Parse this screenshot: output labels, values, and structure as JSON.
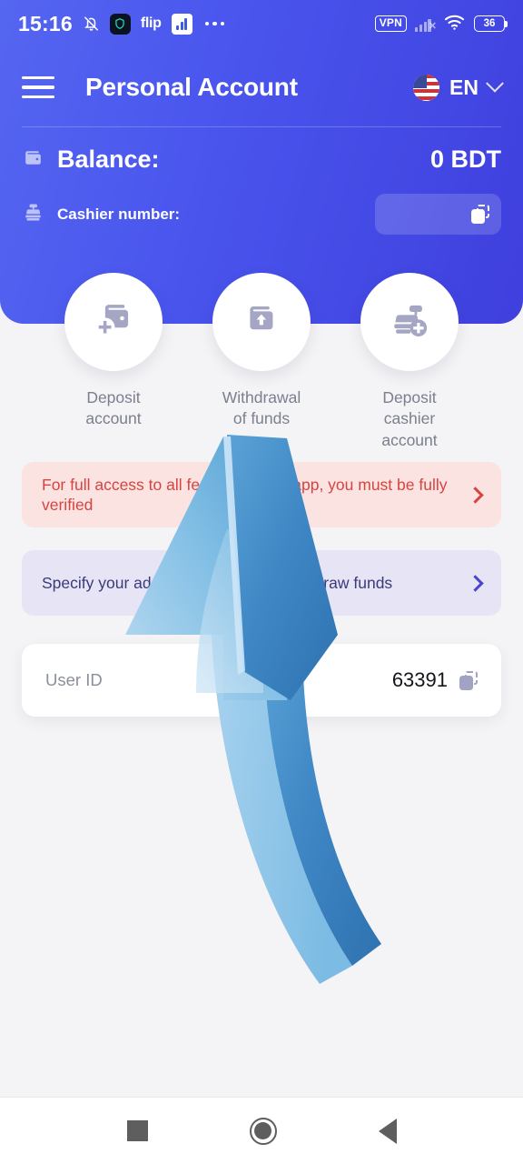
{
  "status_bar": {
    "time": "15:16",
    "icons_left": [
      "bell-off-icon",
      "shield-vpn-icon",
      "flip-app-icon",
      "chart-app-icon",
      "more-dots-icon"
    ],
    "flip_label": "flip",
    "vpn_label": "VPN",
    "battery_level": "36",
    "icons_right": [
      "vpn-badge",
      "signal-icon",
      "wifi-icon",
      "battery-icon"
    ]
  },
  "header": {
    "menu_icon": "hamburger-menu-icon",
    "title": "Personal Account",
    "language": {
      "flag": "us-flag-icon",
      "code": "EN",
      "chevron": "chevron-down-icon"
    },
    "balance": {
      "icon": "wallet-icon",
      "label": "Balance:",
      "value": "0 BDT"
    },
    "cashier": {
      "icon": "cash-register-icon",
      "label": "Cashier number:",
      "value": "",
      "placeholder": "",
      "copy_icon": "copy-icon"
    }
  },
  "actions": [
    {
      "icon": "wallet-plus-icon",
      "label": "Deposit\naccount"
    },
    {
      "icon": "folder-upload-icon",
      "label": "Withdrawal\nof funds"
    },
    {
      "icon": "cash-register-plus-icon",
      "label": "Deposit\ncashier\naccount"
    }
  ],
  "banners": [
    {
      "type": "warning",
      "text": "For full access to all features of the app, you must be fully verified",
      "chevron": "chevron-right-icon",
      "color": "#d8433f",
      "background": "#fbe3e2"
    },
    {
      "type": "info",
      "text": "Specify your address to deposit or withdraw funds",
      "chevron": "chevron-right-icon",
      "color": "#3b3a7a",
      "background": "#e6e4f5"
    }
  ],
  "user_id_card": {
    "label": "User ID",
    "value": "63391",
    "copy_icon": "copy-icon"
  },
  "overlay": {
    "annotation": "upward-curved-arrow",
    "color_light": "#a8d2ef",
    "color_dark": "#3f86c4"
  },
  "navbar": {
    "items": [
      {
        "icon": "recents-square-icon",
        "label": "Recents"
      },
      {
        "icon": "home-circle-icon",
        "label": "Home"
      },
      {
        "icon": "back-triangle-icon",
        "label": "Back"
      }
    ]
  },
  "theme": {
    "header_blue_start": "#5566f0",
    "header_blue_end": "#3f3fdd",
    "page_bg": "#f4f4f6",
    "muted_text": "#7b7f8e"
  }
}
